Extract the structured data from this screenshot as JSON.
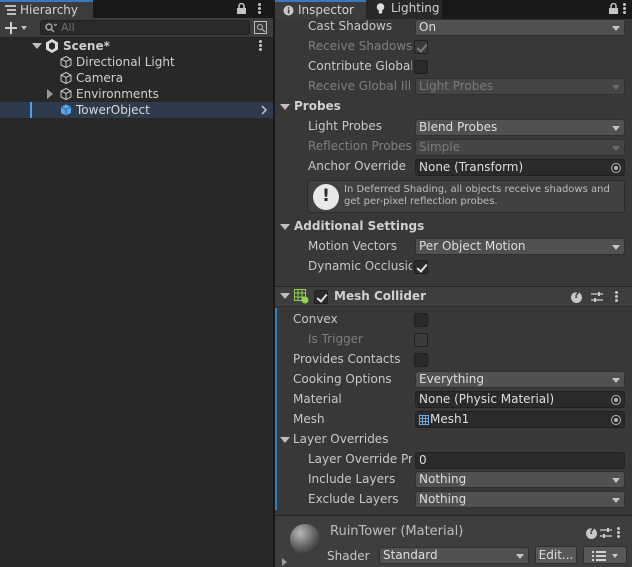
{
  "hierarchy": {
    "tab_label": "Hierarchy",
    "search_placeholder": "All",
    "scene_name": "Scene*",
    "items": [
      {
        "label": "Directional Light"
      },
      {
        "label": "Camera"
      },
      {
        "label": "Environments"
      },
      {
        "label": "TowerObject"
      }
    ]
  },
  "inspector": {
    "tabs": [
      {
        "label": "Inspector"
      },
      {
        "label": "Lighting"
      }
    ],
    "lighting_rows": {
      "cast_shadows": {
        "label": "Cast Shadows",
        "value": "On"
      },
      "receive_shadows": {
        "label": "Receive Shadows",
        "checked": true
      },
      "contribute_gi": {
        "label": "Contribute Global I",
        "checked": false
      },
      "receive_gi": {
        "label": "Receive Global Illu",
        "value": "Light Probes"
      }
    },
    "probes": {
      "title": "Probes",
      "light_probes": {
        "label": "Light Probes",
        "value": "Blend Probes"
      },
      "reflection_probes": {
        "label": "Reflection Probes",
        "value": "Simple"
      },
      "anchor_override": {
        "label": "Anchor Override",
        "value": "None (Transform)"
      },
      "help_message": "In Deferred Shading, all objects receive shadows and get per-pixel reflection probes."
    },
    "additional": {
      "title": "Additional Settings",
      "motion_vectors": {
        "label": "Motion Vectors",
        "value": "Per Object Motion"
      },
      "dynamic_occlusion": {
        "label": "Dynamic Occlusio",
        "checked": true
      }
    },
    "mesh_collider": {
      "title": "Mesh Collider",
      "enabled": true,
      "convex": {
        "label": "Convex",
        "checked": false
      },
      "is_trigger": {
        "label": "Is Trigger",
        "checked": false
      },
      "provides_contacts": {
        "label": "Provides Contacts",
        "checked": false
      },
      "cooking_options": {
        "label": "Cooking Options",
        "value": "Everything"
      },
      "material": {
        "label": "Material",
        "value": "None (Physic Material)"
      },
      "mesh": {
        "label": "Mesh",
        "value": "Mesh1"
      },
      "layer_overrides": {
        "title": "Layer Overrides",
        "priority": {
          "label": "Layer Override Prio",
          "value": "0"
        },
        "include": {
          "label": "Include Layers",
          "value": "Nothing"
        },
        "exclude": {
          "label": "Exclude Layers",
          "value": "Nothing"
        }
      }
    },
    "material": {
      "name": "RuinTower (Material)",
      "shader_label": "Shader",
      "shader_value": "Standard",
      "edit_label": "Edit..."
    }
  },
  "colors": {
    "accent": "#3a78c2",
    "selection": "#2e3b4c",
    "prefab_blue": "#5aa5e6"
  }
}
